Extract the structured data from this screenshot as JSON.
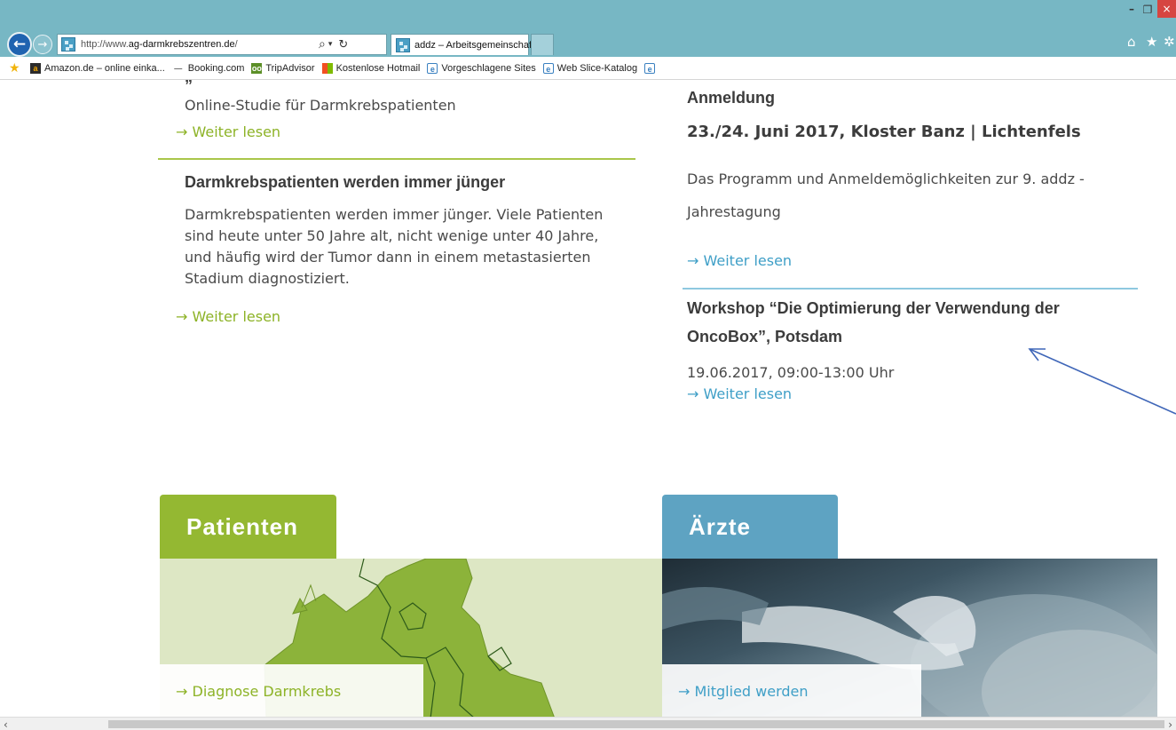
{
  "browser": {
    "url_prefix": "http://www.",
    "url_host": "ag-darmkrebszentren.de",
    "url_suffix": "/",
    "tab_title": "addz – Arbeitsgemeinschaft...",
    "tab_close": "×",
    "search_glyph": "⌕",
    "dropdown_glyph": "▾",
    "refresh_glyph": "↻",
    "back_glyph": "←",
    "forward_glyph": "→",
    "win_min": "–",
    "win_max": "❐",
    "win_close": "×",
    "home_icon": "⌂",
    "star_icon": "★",
    "gear_icon": "✲",
    "accent_color": "#77b7c4"
  },
  "favorites": [
    {
      "icon": "a",
      "label": "Amazon.de – online einka..."
    },
    {
      "icon": "—",
      "label": "Booking.com"
    },
    {
      "icon": "oo",
      "label": "TripAdvisor"
    },
    {
      "icon": "",
      "label": "Kostenlose Hotmail"
    },
    {
      "icon": "e",
      "label": "Vorgeschlagene Sites"
    },
    {
      "icon": "e",
      "label": "Web Slice-Katalog"
    },
    {
      "icon": "e",
      "label": ""
    }
  ],
  "left_column": {
    "article1": {
      "cut_heading": "„",
      "body": "Online-Studie für Darmkrebspatienten",
      "link": "→ Weiter lesen"
    },
    "article2": {
      "heading": "Darmkrebspatienten werden immer jünger",
      "body_lines": [
        "Darmkrebspatienten werden immer jünger. Viele Patienten",
        "sind heute unter 50 Jahre alt, nicht wenige unter 40 Jahre,",
        "und häufig wird der Tumor dann in einem metastasierten",
        "Stadium diagnostiziert."
      ],
      "link": "→ Weiter lesen"
    }
  },
  "right_column": {
    "event1": {
      "heading": "Anmeldung",
      "date": "23./24. Juni 2017, Kloster Banz | Lichtenfels",
      "body_lines": [
        "Das Programm und Anmeldemöglichkeiten zur 9. addz -",
        "Jahrestagung"
      ],
      "link": "→ Weiter lesen"
    },
    "event2": {
      "heading_lines": [
        "Workshop “Die Optimierung der Verwendung der",
        "OncoBox”, Potsdam"
      ],
      "date": "19.06.2017, 09:00-13:00 Uhr",
      "link": "→ Weiter lesen"
    }
  },
  "tiles": {
    "patienten": {
      "label": "Patienten",
      "link": "→ Diagnose Darmkrebs",
      "color": "#94b832"
    },
    "aerzte": {
      "label": "Ärzte",
      "link": "→ Mitglied werden",
      "color": "#5ea3c2"
    }
  },
  "scrollbar": {
    "left_arrow": "‹",
    "right_arrow": "›"
  }
}
